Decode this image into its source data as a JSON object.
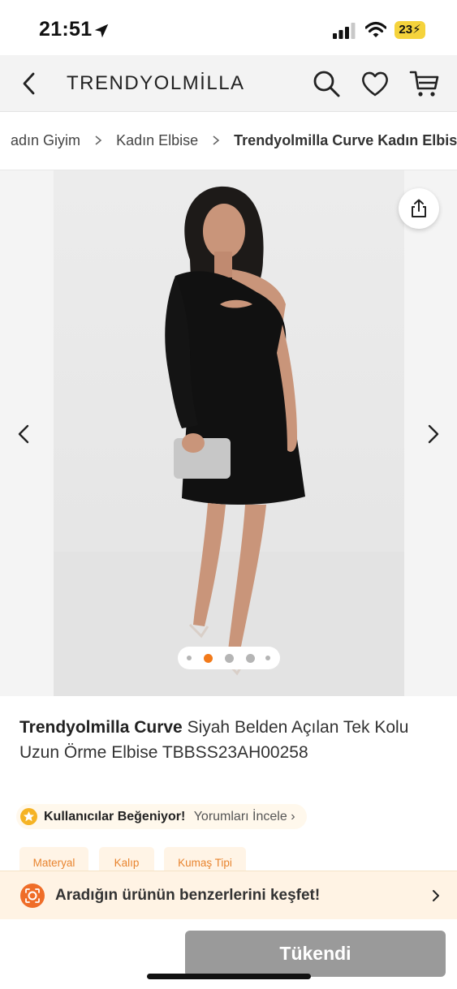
{
  "status_bar": {
    "time": "21:51",
    "battery": "23",
    "icons": [
      "location-arrow-icon",
      "signal-icon",
      "wifi-icon",
      "battery-icon"
    ]
  },
  "navbar": {
    "brand": "TRENDYOLMİLLA",
    "icons": [
      "back-chevron-icon",
      "search-icon",
      "heart-icon",
      "cart-icon"
    ]
  },
  "breadcrumb": {
    "items": [
      "adın Giyim",
      "Kadın Elbise",
      "Trendyolmilla Curve Kadın Elbise"
    ]
  },
  "gallery": {
    "image_count": 5,
    "active_index": 1,
    "active_color": "#f27a1a",
    "icons": [
      "share-icon",
      "arrow-left-icon",
      "arrow-right-icon"
    ]
  },
  "product": {
    "brand": "Trendyolmilla Curve",
    "name": "Siyah Belden Açılan Tek Kolu Uzun Örme Elbise TBBSS23AH00258"
  },
  "rating": {
    "label": "Kullanıcılar Beğeniyor!",
    "link": "Yorumları İncele ›"
  },
  "tags": [
    "Materyal",
    "Kalıp",
    "Kumaş Tipi"
  ],
  "similar_banner": {
    "text": "Aradığın ürünün benzerlerini keşfet!",
    "accent": "#ef6d28"
  },
  "bottom": {
    "soldout_label": "Tükendi"
  }
}
